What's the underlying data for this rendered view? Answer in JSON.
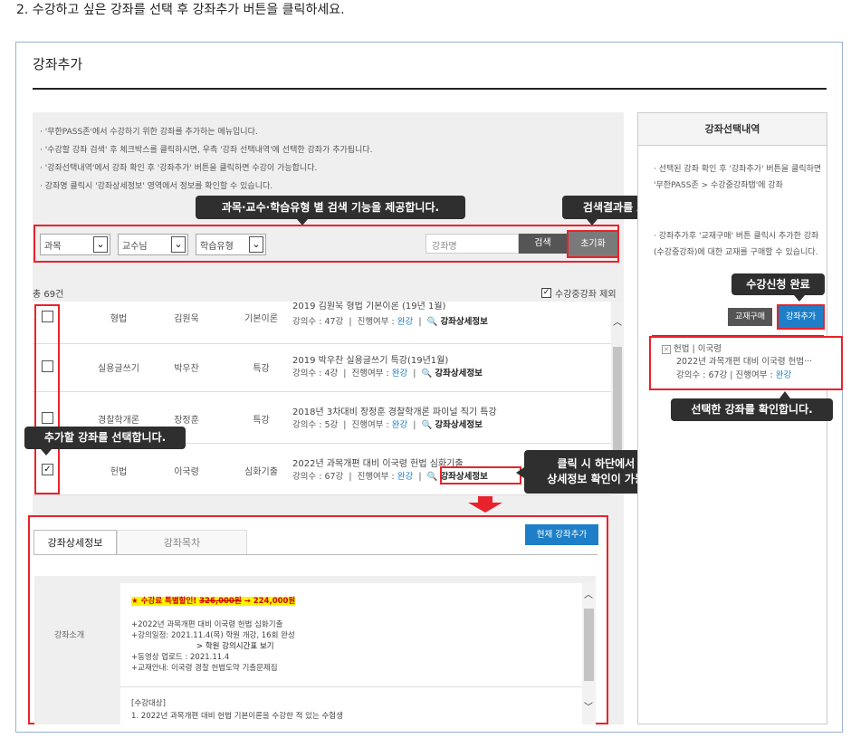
{
  "instruction": "2. 수강하고 싶은 강좌를 선택 후 강좌추가 버튼을 클릭하세요.",
  "panel_title": "강좌추가",
  "notes": [
    "· '무한PASS존'에서 수강하기 위한 강좌를 추가하는 메뉴입니다.",
    "· '수강할 강좌 검색' 후 체크박스를 클릭하시면, 우측 '강좌 선택내역'에 선택한 강좌가 추가됩니다.",
    "· '강좌선택내역'에서 강좌 확인 후 '강좌추가' 버튼을 클릭하면 수강이 가능합니다.",
    "· 강좌명 클릭시 '강좌상세정보' 영역에서 정보를 확인할 수 있습니다."
  ],
  "callouts": {
    "search": "과목·교수·학습유형 별 검색 기능을 제공합니다.",
    "reset": "검색결과를 초기화합니다.",
    "complete": "수강신청 완료",
    "select": "추가할 강좌를 선택합니다.",
    "confirm": "선택한 강좌를 확인합니다.",
    "detail_line1": "클릭 시 하단에서 강좌의",
    "detail_line2": "상세정보 확인이 가능합니다."
  },
  "filters": {
    "subject": "과목",
    "professor": "교수님",
    "learning_type": "학습유형",
    "search_placeholder": "강좌명",
    "search_button": "검색",
    "reset_button": "초기화"
  },
  "list": {
    "count": "총 69건",
    "exclude_label": "수강중강좌 제외",
    "rows": [
      {
        "subject": "형법",
        "professor": "김원욱",
        "type": "기본이론",
        "title": "2019 김원욱 형법 기본이론 (19년 1월)",
        "meta_count": "강의수 : 47강",
        "meta_status_label": "진행여부 :",
        "meta_status": "완강",
        "detail": "강좌상세정보",
        "checked": false
      },
      {
        "subject": "실용글쓰기",
        "professor": "박우찬",
        "type": "특강",
        "title": "2019 박우찬 실용글쓰기 특강(19년1월)",
        "meta_count": "강의수 : 4강",
        "meta_status_label": "진행여부 :",
        "meta_status": "완강",
        "detail": "강좌상세정보",
        "checked": false
      },
      {
        "subject": "경찰학개론",
        "professor": "장정훈",
        "type": "특강",
        "title": "2018년 3차대비 장정훈 경찰학개론 파이널 직기 특강",
        "meta_count": "강의수 : 5강",
        "meta_status_label": "진행여부 :",
        "meta_status": "완강",
        "detail": "강좌상세정보",
        "checked": false
      },
      {
        "subject": "헌법",
        "professor": "이국령",
        "type": "심화기출",
        "title": "2022년 과목개편 대비 이국령 헌법 심화기출",
        "meta_count": "강의수 : 67강",
        "meta_status_label": "진행여부 :",
        "meta_status": "완강",
        "detail": "강좌상세정보",
        "checked": true
      }
    ]
  },
  "right": {
    "header": "강좌선택내역",
    "note1": "· 선택된 강좌 확인 후 '강좌추가' 버튼을 클릭하면 '무한PASS존 > 수강중강좌탭'에 강좌",
    "note2": "· 강좌추가후 '교재구매' 버튼 클릭시 추가한 강좌(수강중강좌)에 대한 교재를 구매할 수 있습니다.",
    "book_button": "교재구매",
    "add_button": "강좌추가",
    "selected": {
      "head": "헌법 | 이국령",
      "title": "2022년 과목개편 대비 이국령 헌법···",
      "meta_prefix": "강의수 : 67강 | 진행여부 :",
      "meta_status": "완강"
    }
  },
  "detail": {
    "tab_active": "강좌상세정보",
    "tab_inactive": "강좌목차",
    "add_current": "현재 강좌추가",
    "row_label": "강좌소개",
    "sale_prefix": "★ 수강료 특별할인!",
    "price_old": "326,000원",
    "price_new": "→ 224,000원",
    "lines": [
      "+2022년 과목개편 대비 이국령 헌법 심화기출",
      "+강의일정: 2021.11.4(목) 학원 개강, 16회 완성",
      "> 학원 강의시간표 보기",
      "+동영상 업로드 : 2021.11.4",
      "+교재안내: 이국령 경찰 헌법도약 기출문제집"
    ],
    "section_title": "[수강대상]",
    "section_line": "1. 2022년 과목개편 대비 헌법 기본이론을 수강한 적 있는 수험생"
  },
  "colors": {
    "accent_blue": "#1e7fc8",
    "highlight_red": "#e8232b",
    "callout_bg": "#2f2f2f"
  }
}
